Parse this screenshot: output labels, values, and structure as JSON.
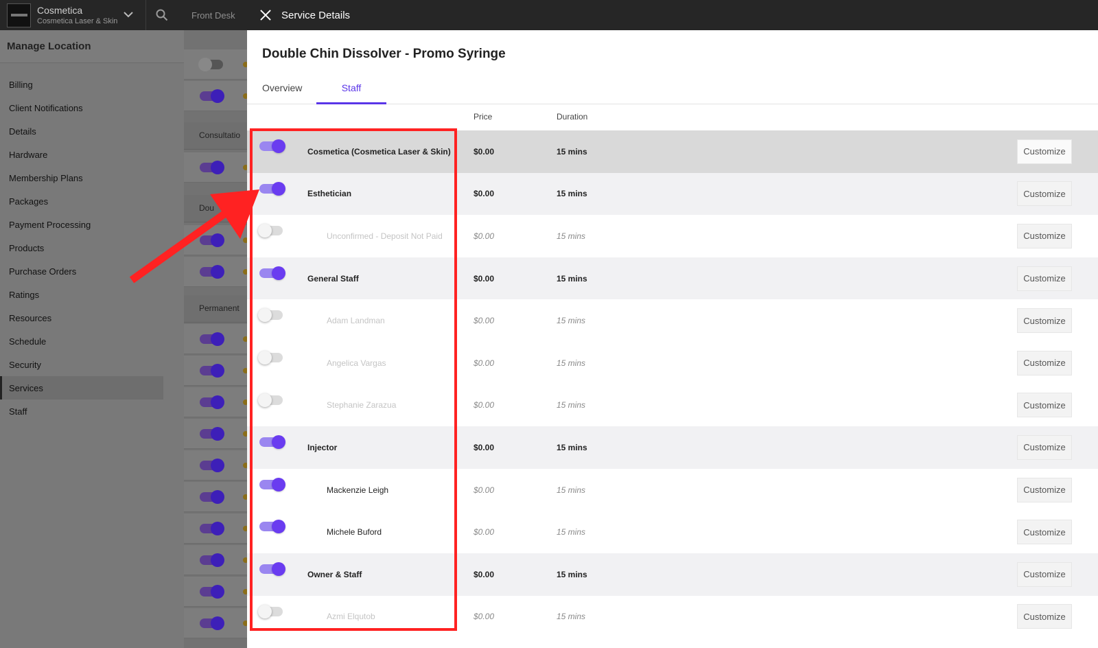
{
  "topbar": {
    "brand_name": "Cosmetica",
    "brand_sub": "Cosmetica Laser & Skin",
    "front_desk": "Front Desk"
  },
  "sidebar": {
    "heading": "Manage Location",
    "items": [
      {
        "label": "Billing"
      },
      {
        "label": "Client Notifications"
      },
      {
        "label": "Details"
      },
      {
        "label": "Hardware"
      },
      {
        "label": "Membership Plans"
      },
      {
        "label": "Packages"
      },
      {
        "label": "Payment Processing"
      },
      {
        "label": "Products"
      },
      {
        "label": "Purchase Orders"
      },
      {
        "label": "Ratings"
      },
      {
        "label": "Resources"
      },
      {
        "label": "Schedule"
      },
      {
        "label": "Security"
      },
      {
        "label": "Services",
        "active": true
      },
      {
        "label": "Staff"
      }
    ]
  },
  "middle": {
    "groups": [
      "Consultatio",
      "Dou",
      "Permanent"
    ]
  },
  "panel": {
    "title": "Service Details",
    "service_name": "Double Chin Dissolver - Promo Syringe",
    "tabs": [
      {
        "label": "Overview",
        "active": false
      },
      {
        "label": "Staff",
        "active": true
      }
    ],
    "columns": {
      "price": "Price",
      "duration": "Duration"
    },
    "customize_label": "Customize",
    "rows": [
      {
        "name": "Cosmetica (Cosmetica Laser & Skin)",
        "type": "group",
        "enabled": true,
        "price": "$0.00",
        "duration": "15 mins"
      },
      {
        "name": "Esthetician",
        "type": "group",
        "enabled": true,
        "price": "$0.00",
        "duration": "15 mins"
      },
      {
        "name": "Unconfirmed - Deposit Not Paid",
        "type": "staff",
        "enabled": false,
        "price": "$0.00",
        "duration": "15 mins"
      },
      {
        "name": "General Staff",
        "type": "group",
        "enabled": true,
        "price": "$0.00",
        "duration": "15 mins"
      },
      {
        "name": "Adam Landman",
        "type": "staff",
        "enabled": false,
        "price": "$0.00",
        "duration": "15 mins"
      },
      {
        "name": "Angelica Vargas",
        "type": "staff",
        "enabled": false,
        "price": "$0.00",
        "duration": "15 mins"
      },
      {
        "name": "Stephanie Zarazua",
        "type": "staff",
        "enabled": false,
        "price": "$0.00",
        "duration": "15 mins"
      },
      {
        "name": "Injector",
        "type": "group",
        "enabled": true,
        "price": "$0.00",
        "duration": "15 mins"
      },
      {
        "name": "Mackenzie Leigh",
        "type": "staff",
        "enabled": true,
        "price": "$0.00",
        "duration": "15 mins"
      },
      {
        "name": "Michele Buford",
        "type": "staff",
        "enabled": true,
        "price": "$0.00",
        "duration": "15 mins"
      },
      {
        "name": "Owner & Staff",
        "type": "group",
        "enabled": true,
        "price": "$0.00",
        "duration": "15 mins"
      },
      {
        "name": "Azmi Elqutob",
        "type": "staff",
        "enabled": false,
        "price": "$0.00",
        "duration": "15 mins"
      }
    ]
  },
  "colors": {
    "accent": "#5a35e8",
    "annotation": "#f22222",
    "topbar": "#262626"
  }
}
